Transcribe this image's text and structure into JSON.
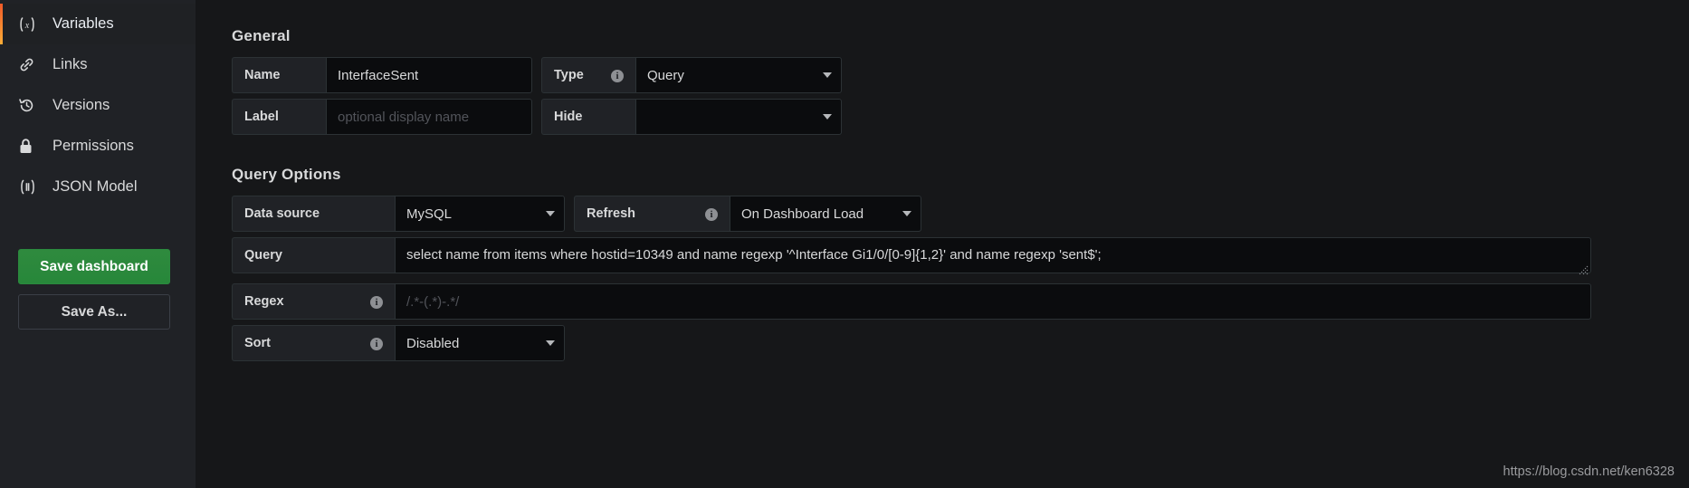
{
  "sidebar": {
    "items": [
      {
        "label": "Variables",
        "icon": "variables-icon",
        "active": true
      },
      {
        "label": "Links",
        "icon": "link-icon",
        "active": false
      },
      {
        "label": "Versions",
        "icon": "history-icon",
        "active": false
      },
      {
        "label": "Permissions",
        "icon": "lock-icon",
        "active": false
      },
      {
        "label": "JSON Model",
        "icon": "json-braces-icon",
        "active": false
      }
    ],
    "save_dashboard_label": "Save dashboard",
    "save_as_label": "Save As...",
    "accent_color": "#f05a28",
    "primary_button_color": "#2f8a3e"
  },
  "general": {
    "title": "General",
    "name_label": "Name",
    "name_value": "InterfaceSent",
    "name_placeholder": "",
    "type_label": "Type",
    "type_value": "Query",
    "label_label": "Label",
    "label_value": "",
    "label_placeholder": "optional display name",
    "hide_label": "Hide",
    "hide_value": ""
  },
  "query_options": {
    "title": "Query Options",
    "datasource_label": "Data source",
    "datasource_value": "MySQL",
    "refresh_label": "Refresh",
    "refresh_value": "On Dashboard Load",
    "query_label": "Query",
    "query_value": "select name from items where hostid=10349 and name regexp '^Interface Gi1/0/[0-9]{1,2}' and name regexp 'sent$';",
    "regex_label": "Regex",
    "regex_value": "",
    "regex_placeholder": "/.*-(.*)-.*/",
    "sort_label": "Sort",
    "sort_value": "Disabled"
  },
  "watermark": "https://blog.csdn.net/ken6328"
}
